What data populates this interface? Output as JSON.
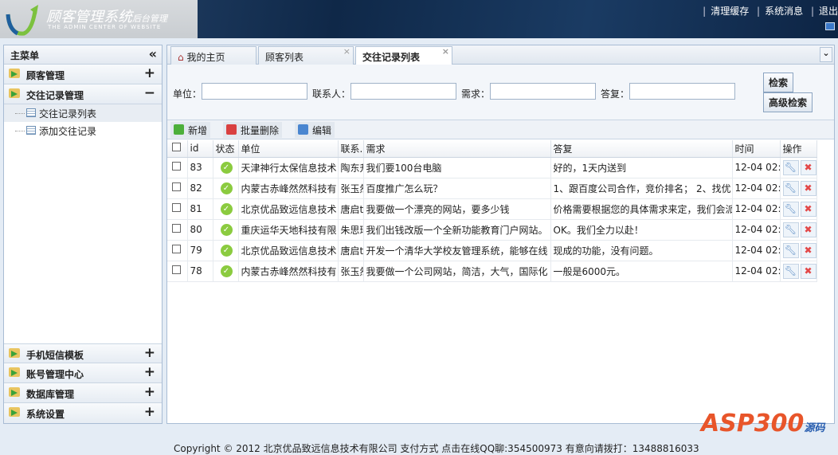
{
  "header": {
    "title": "顾客管理系统",
    "title_suffix": "后台管理",
    "subtitle": "THE ADMIN CENTER OF WEBSITE",
    "links": [
      "清理缓存",
      "系统消息",
      "退出"
    ]
  },
  "sidebar": {
    "title": "主菜单",
    "groups": [
      {
        "label": "顾客管理",
        "toggle": "+"
      },
      {
        "label": "交往记录管理",
        "toggle": "−",
        "items": [
          "交往记录列表",
          "添加交往记录"
        ]
      }
    ],
    "bottom_groups": [
      {
        "label": "手机短信模板",
        "toggle": "+"
      },
      {
        "label": "账号管理中心",
        "toggle": "+"
      },
      {
        "label": "数据库管理",
        "toggle": "+"
      },
      {
        "label": "系统设置",
        "toggle": "+"
      }
    ]
  },
  "tabs": [
    {
      "label": "我的主页",
      "icon": "home-icon"
    },
    {
      "label": "顾客列表"
    },
    {
      "label": "交往记录列表",
      "active": true
    }
  ],
  "search": {
    "unit_label": "单位：",
    "contact_label": "联系人：",
    "need_label": "需求：",
    "reply_label": "答复：",
    "unit_value": "",
    "contact_value": "",
    "need_value": "",
    "reply_value": "",
    "search_btn": "检索",
    "adv_btn": "高级检索"
  },
  "toolbar": {
    "add": "新增",
    "batch_delete": "批量删除",
    "edit": "编辑"
  },
  "table": {
    "headers": [
      "id",
      "状态",
      "单位",
      "联系.",
      "需求",
      "答复",
      "时间",
      "操作"
    ],
    "rows": [
      {
        "id": "83",
        "unit": "天津神行太保信息技术",
        "contact": "陶东升",
        "need": "我们要100台电脑",
        "reply": "好的，1天内送到",
        "time": "12-04 02:2"
      },
      {
        "id": "82",
        "unit": "内蒙古赤峰然然科技有",
        "contact": "张玉然",
        "need": "百度推广怎么玩？",
        "reply": "1、跟百度公司合作，竞价排名； 2、找优",
        "time": "12-04 02:2"
      },
      {
        "id": "81",
        "unit": "北京优品致远信息技术",
        "contact": "唐启t",
        "need": "我要做一个漂亮的网站，要多少钱",
        "reply": "价格需要根据您的具体需求来定，我们会派",
        "time": "12-04 02:2"
      },
      {
        "id": "80",
        "unit": "重庆运华天地科技有限",
        "contact": "朱思瑶",
        "need": "我们出钱改版一个全新功能教育门户网站。",
        "reply": "OK。我们全力以赴！",
        "time": "12-04 02:2"
      },
      {
        "id": "79",
        "unit": "北京优品致远信息技术",
        "contact": "唐启t",
        "need": "开发一个清华大学校友管理系统，能够在线",
        "reply": "现成的功能，没有问题。",
        "time": "12-04 02:2"
      },
      {
        "id": "78",
        "unit": "内蒙古赤峰然然科技有",
        "contact": "张玉然",
        "need": "我要做一个公司网站，简洁，大气，国际化",
        "reply": "一般是6000元。",
        "time": "12-04 02:2"
      }
    ]
  },
  "footer": "Copyright © 2012 北京优品致远信息技术有限公司  支付方式  点击在线QQ聊:354500973  有意向请拨打：13488816033",
  "watermark": {
    "text": "ASP300",
    "suffix": "源码"
  }
}
